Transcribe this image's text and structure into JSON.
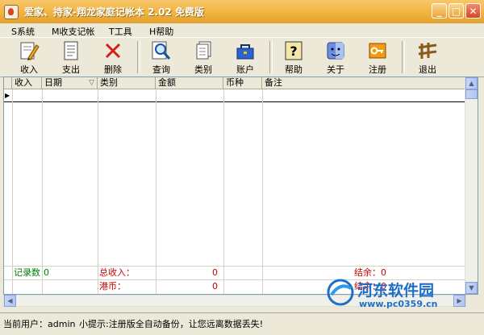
{
  "window": {
    "title": "爱家、持家-翔龙家庭记帐本 2.02 免费版",
    "controls": {
      "minimize": "_",
      "maximize": "□",
      "close": "✕"
    }
  },
  "menu": [
    {
      "key": "S",
      "label": "S系统"
    },
    {
      "key": "M",
      "label": "M收支记帐"
    },
    {
      "key": "T",
      "label": "T工具"
    },
    {
      "key": "H",
      "label": "H帮助"
    }
  ],
  "toolbar": [
    {
      "label": "收入",
      "icon": "pencil-icon"
    },
    {
      "label": "支出",
      "icon": "document-icon"
    },
    {
      "label": "删除",
      "icon": "delete-x-icon"
    },
    {
      "label": "查询",
      "icon": "magnifier-icon"
    },
    {
      "label": "类别",
      "icon": "pages-icon"
    },
    {
      "label": "账户",
      "icon": "toolbox-icon"
    },
    {
      "label": "帮助",
      "icon": "help-icon"
    },
    {
      "label": "关于",
      "icon": "finder-face-icon"
    },
    {
      "label": "注册",
      "icon": "key-icon"
    },
    {
      "label": "退出",
      "icon": "exit-icon"
    }
  ],
  "grid": {
    "columns": [
      "收入",
      "日期",
      "类别",
      "金额",
      "币种",
      "备注"
    ],
    "sort_indicator": "▽",
    "row_marker": "▶",
    "summary": {
      "record_count_label": "记录数",
      "record_count_value": "0",
      "total_income_label": "总收入：",
      "total_income_value": "0",
      "balance_label": "结余：0",
      "currency_label": "港币：",
      "currency_value": "0",
      "balance2_label": "结余：0"
    }
  },
  "status": {
    "user_label": "当前用户：admin",
    "tip": "小提示:注册版全自动备份，让您远离数据丢失!"
  },
  "watermark": {
    "name": "河东软件园",
    "url": "www.pc0359.cn"
  },
  "colors": {
    "title_bar": "#f3b540",
    "summary_green": "#008000",
    "summary_red": "#cc0000",
    "watermark_blue": "#1e6fc8"
  }
}
